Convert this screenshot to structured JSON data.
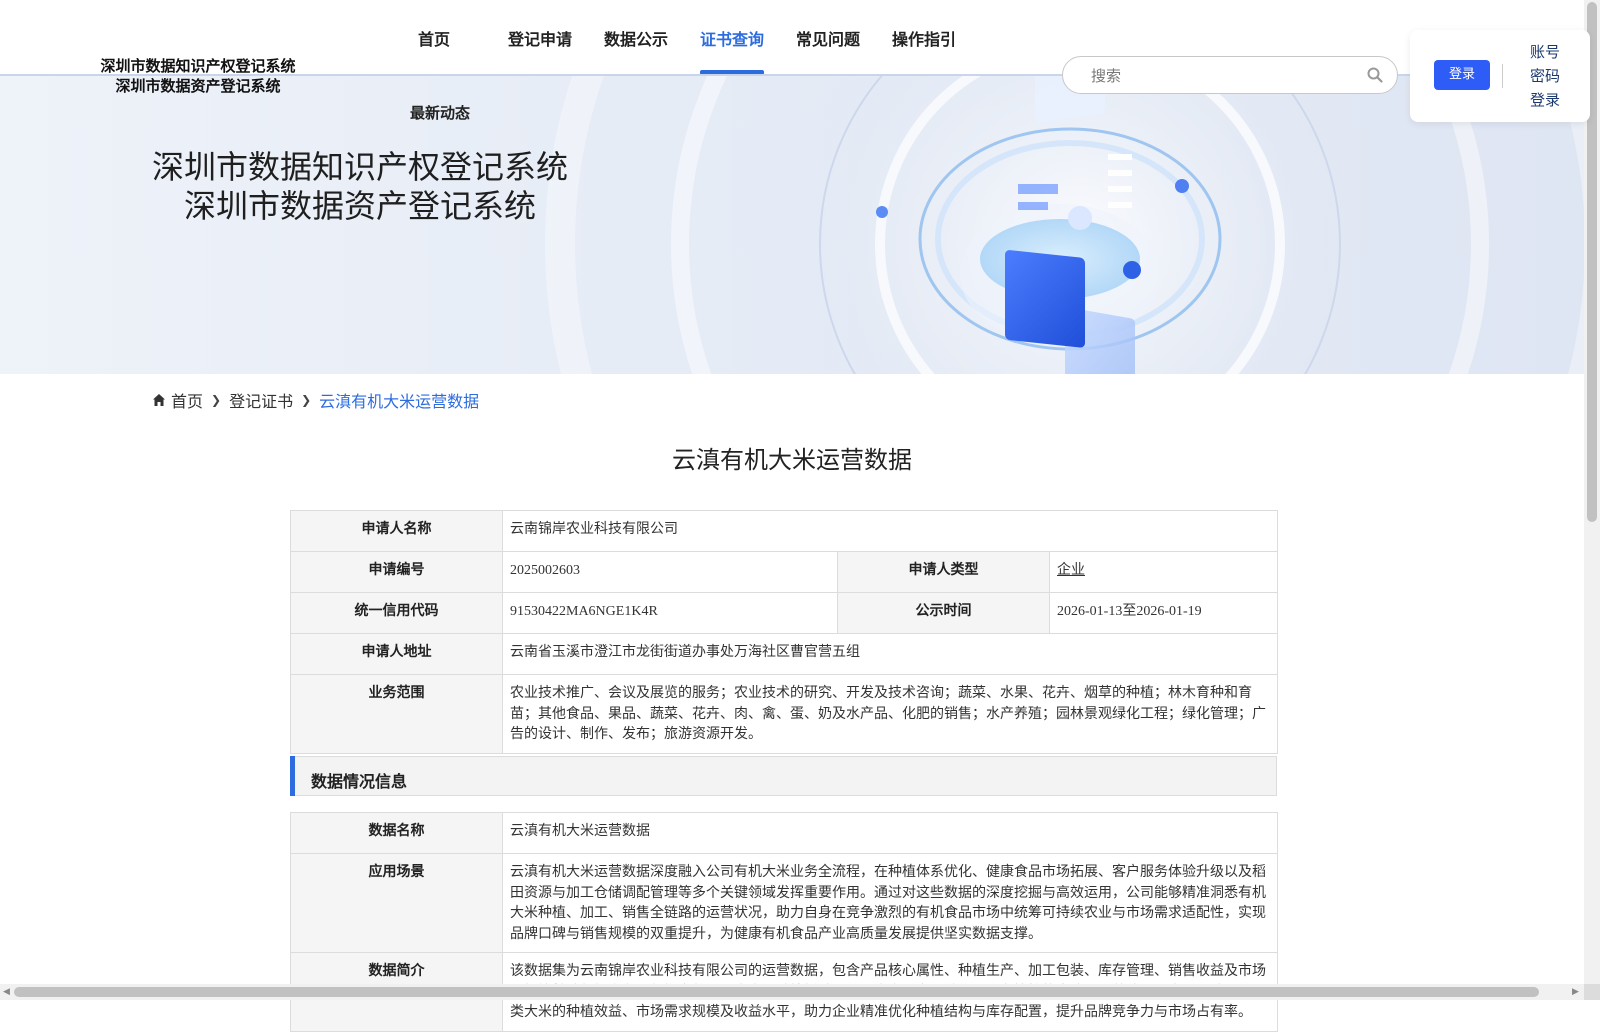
{
  "header": {
    "logo_line1": "深圳市数据知识产权登记系统",
    "logo_line2": "深圳市数据资产登记系统",
    "nav": [
      "首页",
      "登记申请",
      "数据公示",
      "证书查询",
      "常见问题",
      "操作指引"
    ],
    "nav_active_index": 3,
    "nav_sub": "最新动态",
    "search_placeholder": "搜索",
    "login_button": "登录",
    "login_links": [
      "账号",
      "密码",
      "登录"
    ]
  },
  "banner": {
    "title_line1": "深圳市数据知识产权登记系统",
    "title_line2": "深圳市数据资产登记系统"
  },
  "breadcrumb": {
    "home": "首页",
    "level2": "登记证书",
    "current": "云滇有机大米运营数据"
  },
  "page_title": "云滇有机大米运营数据",
  "applicant": {
    "name_label": "申请人名称",
    "name": "云南锦岸农业科技有限公司",
    "code_label": "申请编号",
    "code": "2025002603",
    "type_label": "申请人类型",
    "type": "企业",
    "credit_label": "统一信用代码",
    "credit": "91530422MA6NGE1K4R",
    "publish_label": "公示时间",
    "publish": "2026-01-13至2026-01-19",
    "address_label": "申请人地址",
    "address": "云南省玉溪市澄江市龙街街道办事处万海社区曹官营五组",
    "scope_label": "业务范围",
    "scope": "农业技术推广、会议及展览的服务；农业技术的研究、开发及技术咨询；蔬菜、水果、花卉、烟草的种植；林木育种和育苗；其他食品、果品、蔬菜、花卉、肉、禽、蛋、奶及水产品、化肥的销售；水产养殖；园林景观绿化工程；绿化管理；广告的设计、制作、发布；旅游资源开发。"
  },
  "data_section": {
    "heading": "数据情况信息",
    "name_label": "数据名称",
    "name": "云滇有机大米运营数据",
    "scene_label": "应用场景",
    "scene": "云滇有机大米运营数据深度融入公司有机大米业务全流程，在种植体系优化、健康食品市场拓展、客户服务体验升级以及稻田资源与加工仓储调配管理等多个关键领域发挥重要作用。通过对这些数据的深度挖掘与高效运用，公司能够精准洞悉有机大米种植、加工、销售全链路的运营状况，助力自身在竞争激烈的有机食品市场中统筹可持续农业与市场需求适配性，实现品牌口碑与销售规模的双重提升，为健康有机食品产业高质量发展提供坚实数据支撑。",
    "intro_label": "数据简介",
    "intro": "该数据集为云南锦岸农业科技有限公司的运营数据，包含产品核心属性、种植生产、加工包装、库存管理、销售收益及市场规划等基础数据字段。数据完整呈现大米从种植播种、加工生产到市场销售、库存管控的全流程运营情况，直观反映不同品类大米的种植效益、市场需求规模及收益水平，助力企业精准优化种植结构与库存配置，提升品牌竞争力与市场占有率。"
  },
  "colors": {
    "accent": "#2d6cdf",
    "login_button": "#2d5cf6",
    "label_bg": "#f5f5f5",
    "border": "#dcdcdc"
  }
}
